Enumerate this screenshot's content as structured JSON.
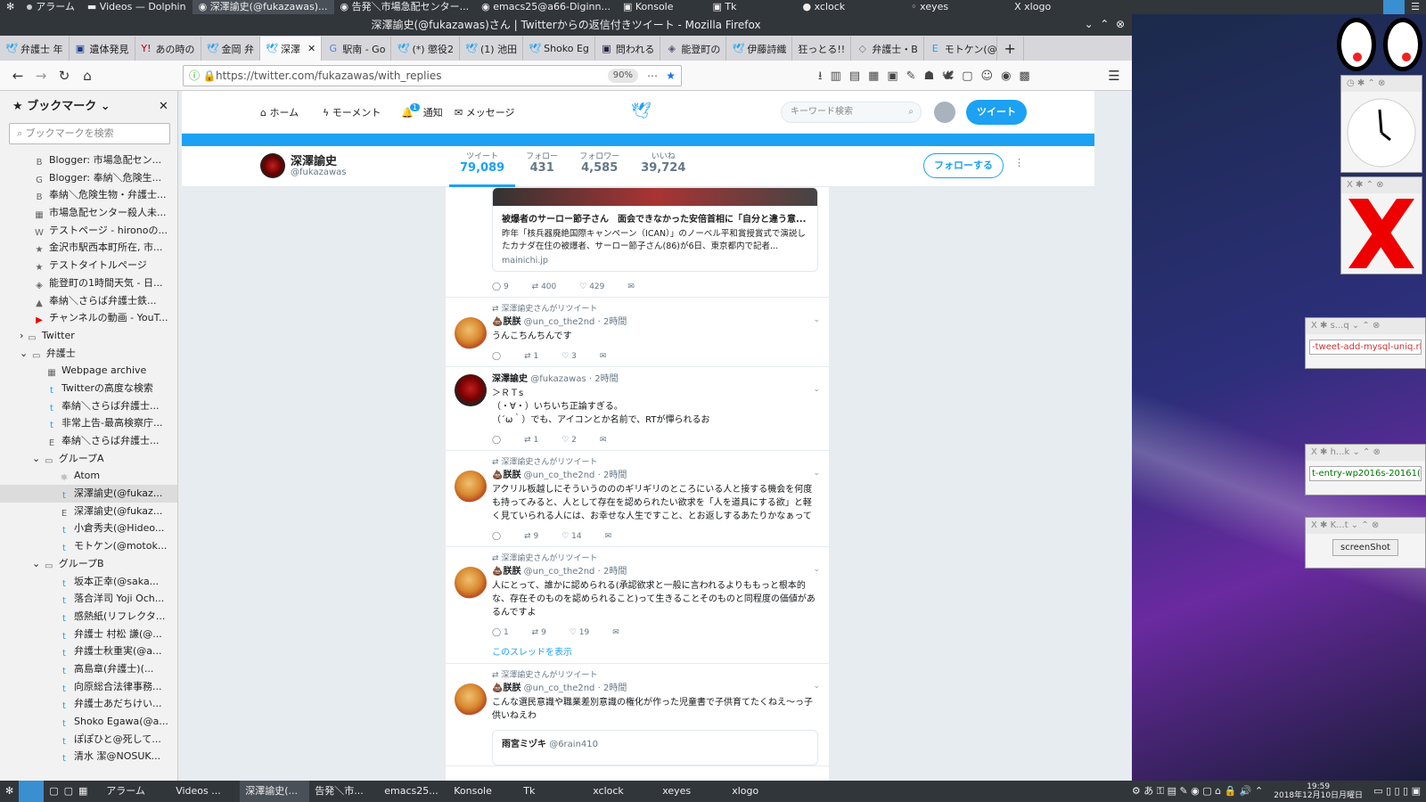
{
  "top_panel": {
    "items": [
      "アラーム",
      "Videos — Dolphin",
      "深澤諭史(@fukazawas)...",
      "告発＼市場急配センター...",
      "emacs25@a66-Diginn...",
      "Konsole",
      "Tk",
      "xclock",
      "xeyes",
      "xlogo"
    ]
  },
  "firefox": {
    "window_title": "深澤諭史(@fukazawas)さん | Twitterからの返信付きツイート - Mozilla Firefox",
    "tabs": [
      "弁護士 年",
      "遺体発見",
      "あの時の",
      "金岡 弁",
      "深澤",
      "駅南 - Go",
      "(*) 懲役2",
      "(1) 池田",
      "Shoko Eg",
      "問われる",
      "能登町の",
      "伊藤詩織",
      "狂っとる!!",
      "弁護士・B",
      "モトケン(@"
    ],
    "url": "https://twitter.com/fukazawas/with_replies",
    "zoom": "90%"
  },
  "sidebar": {
    "title": "ブックマーク",
    "search_placeholder": "ブックマークを検索",
    "items": [
      {
        "label": "Blogger: 市場急配セン...",
        "icon": "B",
        "indent": 1
      },
      {
        "label": "Blogger: 奉納＼危険生...",
        "icon": "G",
        "indent": 1
      },
      {
        "label": "奉納＼危険生物・弁護士...",
        "icon": "B",
        "indent": 1
      },
      {
        "label": "市場急配センター殺人未...",
        "icon": "▦",
        "indent": 1
      },
      {
        "label": "テストページ - hironoの...",
        "icon": "W",
        "indent": 1
      },
      {
        "label": "金沢市駅西本町所在, 市...",
        "icon": "★",
        "indent": 1
      },
      {
        "label": "テストタイトルページ",
        "icon": "★",
        "indent": 1
      },
      {
        "label": "能登町の1時間天気 - 日...",
        "icon": "◈",
        "indent": 1
      },
      {
        "label": "奉納＼さらば弁護士鉄...",
        "icon": "▲",
        "indent": 1
      },
      {
        "label": "チャンネルの動画 - YouT...",
        "icon": "▶",
        "indent": 1
      },
      {
        "label": "Twitter",
        "icon": "▭",
        "indent": 0,
        "folder": "›"
      },
      {
        "label": "弁護士",
        "icon": "▭",
        "indent": 0,
        "folder": "⌄"
      },
      {
        "label": "Webpage archive",
        "icon": "▦",
        "indent": 2
      },
      {
        "label": "Twitterの高度な検索",
        "icon": "t",
        "indent": 2
      },
      {
        "label": "奉納＼さらば弁護士...",
        "icon": "t",
        "indent": 2
      },
      {
        "label": "非常上告-最高検察庁...",
        "icon": "t",
        "indent": 2
      },
      {
        "label": "奉納＼さらば弁護士...",
        "icon": "E",
        "indent": 2
      },
      {
        "label": "グループA",
        "icon": "▭",
        "indent": 1,
        "folder": "⌄"
      },
      {
        "label": "Atom",
        "icon": "⚛",
        "indent": 3
      },
      {
        "label": "深澤諭史(@fukaz...",
        "icon": "t",
        "indent": 3,
        "selected": true
      },
      {
        "label": "深澤諭史(@fukaz...",
        "icon": "E",
        "indent": 3
      },
      {
        "label": "小倉秀夫(@Hideo...",
        "icon": "t",
        "indent": 3
      },
      {
        "label": "モトケン(@motok...",
        "icon": "t",
        "indent": 3
      },
      {
        "label": "グループB",
        "icon": "▭",
        "indent": 1,
        "folder": "⌄"
      },
      {
        "label": "坂本正幸(@saka...",
        "icon": "t",
        "indent": 3
      },
      {
        "label": "落合洋司 Yoji Och...",
        "icon": "t",
        "indent": 3
      },
      {
        "label": "感熱紙(リフレクタ...",
        "icon": "t",
        "indent": 3
      },
      {
        "label": "弁護士 村松 謙(@...",
        "icon": "t",
        "indent": 3
      },
      {
        "label": "弁護士秋重実(@a...",
        "icon": "t",
        "indent": 3
      },
      {
        "label": "高島章(弁護士)(...",
        "icon": "t",
        "indent": 3
      },
      {
        "label": "向原総合法律事務...",
        "icon": "t",
        "indent": 3
      },
      {
        "label": "弁護士あだちけい...",
        "icon": "t",
        "indent": 3
      },
      {
        "label": "Shoko Egawa(@a...",
        "icon": "t",
        "indent": 3
      },
      {
        "label": "ぽぽひと@死して...",
        "icon": "t",
        "indent": 3
      },
      {
        "label": "清水 潔@NOSUK...",
        "icon": "t",
        "indent": 3
      }
    ]
  },
  "twitter_nav": {
    "home": "ホーム",
    "moments": "モーメント",
    "notifications": "通知",
    "notif_count": "1",
    "messages": "メッセージ",
    "search_placeholder": "キーワード検索",
    "tweet_button": "ツイート"
  },
  "profile": {
    "name": "深澤諭史",
    "handle": "@fukazawas",
    "stats": [
      {
        "label": "ツイート",
        "value": "79,089"
      },
      {
        "label": "フォロー",
        "value": "431"
      },
      {
        "label": "フォロワー",
        "value": "4,585"
      },
      {
        "label": "いいね",
        "value": "39,724"
      }
    ],
    "follow_button": "フォローする"
  },
  "card": {
    "title": "被爆者のサーロー節子さん　面会できなかった安倍首相に「自分と違う意...",
    "desc": "昨年「核兵器廃絶国際キャンペーン（ICAN）」のノーベル平和賞授賞式で演説したカナダ在住の被爆者、サーロー節子さん(86)が6日、東京都内で記者...",
    "domain": "mainichi.jp",
    "counts": [
      "9",
      "400",
      "429"
    ]
  },
  "tweets": [
    {
      "rt": "深澤諭史さんがリツイート",
      "name": "💩朕朕",
      "handle": "@un_co_the2nd",
      "time": "· 2時間",
      "text": "うんこちんちんです",
      "counts": [
        "",
        "1",
        "3"
      ]
    },
    {
      "rt": "",
      "name": "深澤諭史",
      "handle": "@fukazawas",
      "time": "· 2時間",
      "text": "＞ＲＴs\n（・∀・）いちいち正論すぎる。\n（´ω｀）でも、アイコンとか名前で、RTが憚られるお",
      "counts": [
        "",
        "1",
        "2"
      ],
      "dark": true
    },
    {
      "rt": "深澤諭史さんがリツイート",
      "name": "💩朕朕",
      "handle": "@un_co_the2nd",
      "time": "· 2時間",
      "text": "アクリル板越しにそういうのののギリギリのところにいる人と接する機会を何度も持ってみると、人として存在を認められたい欲求を「人を道具にする欲」と軽く見ていられる人には、お幸せな人生ですこと、とお返しするあたりかなぁって",
      "counts": [
        "",
        "9",
        "14"
      ]
    },
    {
      "rt": "深澤諭史さんがリツイート",
      "name": "💩朕朕",
      "handle": "@un_co_the2nd",
      "time": "· 2時間",
      "text": "人にとって、誰かに認められる(承認欲求と一般に言われるよりももっと根本的な、存在そのものを認められること)って生きることそのものと同程度の価値があるんですよ",
      "counts": [
        "1",
        "9",
        "19"
      ],
      "thread": "このスレッドを表示"
    },
    {
      "rt": "深澤諭史さんがリツイート",
      "name": "💩朕朕",
      "handle": "@un_co_the2nd",
      "time": "· 2時間",
      "text": "こんな選民意識や職業差別意識の権化が作った児童書で子供育てたくねえ〜っ子供いねえわ",
      "counts": [],
      "quoted": {
        "name": "雨宮ミヅキ",
        "handle": "@6rain410"
      }
    }
  ],
  "widgets": {
    "w1_title": "s...q",
    "w1_text": "-tweet-add-mysql-uniq.rb",
    "w2_title": "h...k",
    "w2_text": "t-entry-wp2016s-20161(",
    "w3_title": "K...t",
    "w3_button": "screenShot"
  },
  "taskbar": {
    "items": [
      "アラーム",
      "Videos ...",
      "深澤諭史(...",
      "告発＼市...",
      "emacs25...",
      "Konsole",
      "Tk",
      "xclock",
      "xeyes",
      "xlogo"
    ],
    "time": "19:59",
    "date": "2018年12月10日月曜日"
  },
  "colors": {
    "twitter_blue": "#1da1f2",
    "panel": "#31363b"
  }
}
